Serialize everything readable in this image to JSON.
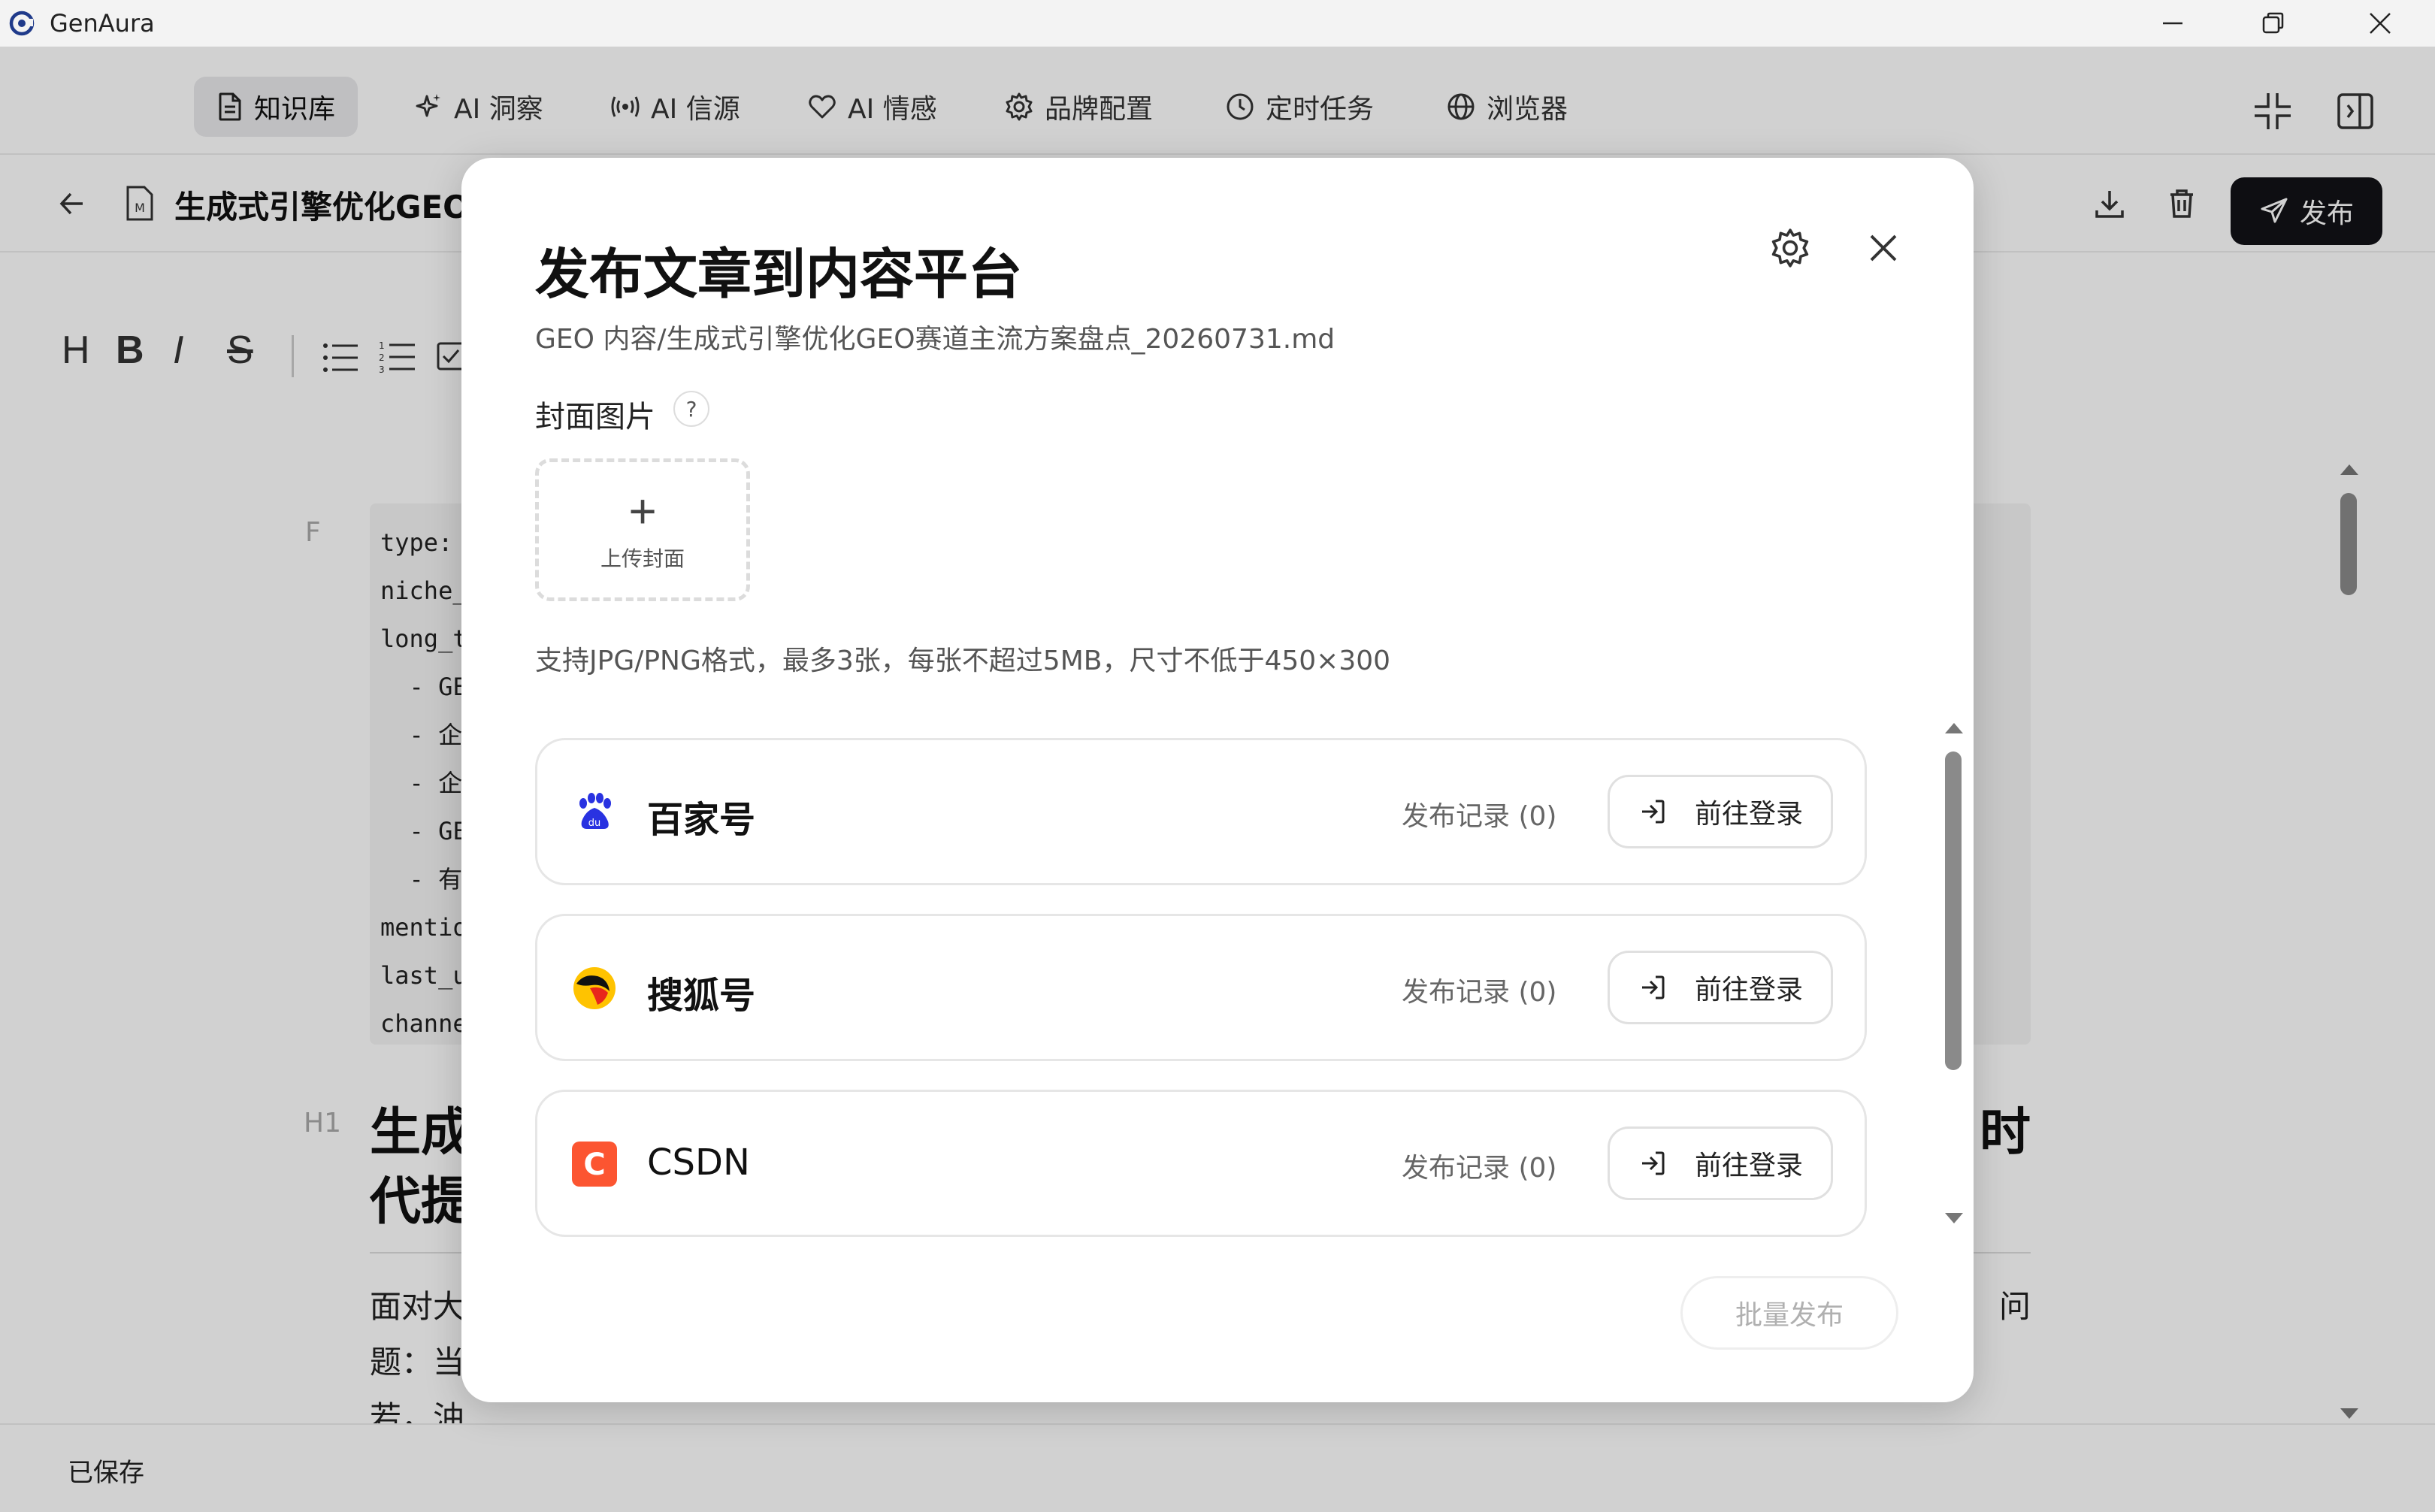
{
  "app": {
    "title": "GenAura"
  },
  "nav": {
    "items": [
      {
        "label": "知识库",
        "icon": "document-icon",
        "active": true
      },
      {
        "label": "AI 洞察",
        "icon": "sparkle-icon",
        "active": false
      },
      {
        "label": "AI 信源",
        "icon": "broadcast-icon",
        "active": false
      },
      {
        "label": "AI 情感",
        "icon": "heart-icon",
        "active": false
      },
      {
        "label": "品牌配置",
        "icon": "gear-icon",
        "active": false
      },
      {
        "label": "定时任务",
        "icon": "clock-icon",
        "active": false
      },
      {
        "label": "浏览器",
        "icon": "globe-icon",
        "active": false
      }
    ]
  },
  "doc": {
    "title": "生成式引擎优化GEO",
    "publish_label": "发布"
  },
  "toolbar": {
    "buttons": [
      "H",
      "B",
      "I",
      "S"
    ]
  },
  "editor": {
    "frontmatter_label": "F",
    "frontmatter_lines": [
      "type:",
      "niche_",
      "long_t",
      "  - GE",
      "  - 企",
      "  - 企",
      "  - GE",
      "  - 有",
      "mentio",
      "last_u",
      "channe"
    ],
    "h1_label": "H1",
    "h1_line1_left": "生成",
    "h1_line1_right": "时",
    "h1_line2_left": "代提",
    "para_line1_left": "面对大",
    "para_line1_right": "问",
    "para_line2_left": "题：当",
    "para_line3_left": "若，油"
  },
  "status": {
    "text": "已保存"
  },
  "modal": {
    "title": "发布文章到内容平台",
    "path": "GEO 内容/生成式引擎优化GEO赛道主流方案盘点_20260731.md",
    "cover_label": "封面图片",
    "help": "?",
    "upload_plus": "+",
    "upload_label": "上传封面",
    "hint": "支持JPG/PNG格式，最多3张，每张不超过5MB，尺寸不低于450×300",
    "platforms": [
      {
        "name": "百家号",
        "icon": "baijiahao-icon",
        "records": "发布记录 (0)",
        "login": "前往登录"
      },
      {
        "name": "搜狐号",
        "icon": "sohu-icon",
        "records": "发布记录 (0)",
        "login": "前往登录"
      },
      {
        "name": "CSDN",
        "icon": "csdn-icon",
        "records": "发布记录 (0)",
        "login": "前往登录"
      }
    ],
    "batch_label": "批量发布"
  },
  "colors": {
    "accent_dark": "#121216",
    "baijiahao_blue": "#2932e1",
    "csdn_orange": "#fc5531",
    "sohu_yellow": "#ffc300"
  }
}
